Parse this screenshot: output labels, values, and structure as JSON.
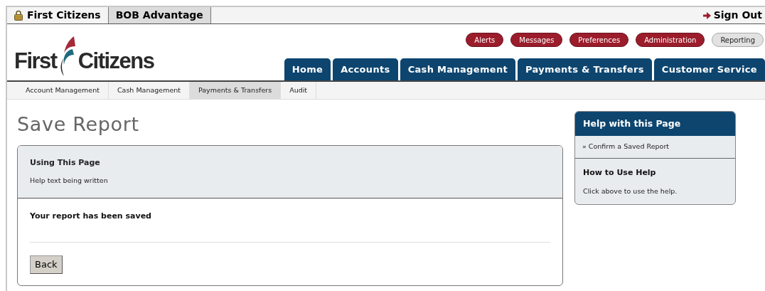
{
  "top_tabs": [
    {
      "label": "First Citizens",
      "kind": "lock",
      "selected": false
    },
    {
      "label": "BOB Advantage",
      "kind": "plain",
      "selected": true
    }
  ],
  "sign_out": "Sign Out",
  "logo": {
    "words": [
      "First",
      "Citizens"
    ]
  },
  "utility_buttons": [
    {
      "label": "Alerts",
      "selected": false
    },
    {
      "label": "Messages",
      "selected": false
    },
    {
      "label": "Preferences",
      "selected": false
    },
    {
      "label": "Administration",
      "selected": false
    },
    {
      "label": "Reporting",
      "selected": true
    }
  ],
  "main_nav": [
    "Home",
    "Accounts",
    "Cash Management",
    "Payments & Transfers",
    "Customer Service"
  ],
  "sub_nav": [
    {
      "label": "Account Management",
      "selected": false
    },
    {
      "label": "Cash Management",
      "selected": false
    },
    {
      "label": "Payments & Transfers",
      "selected": true
    },
    {
      "label": "Audit",
      "selected": false
    }
  ],
  "page_title": "Save Report",
  "panel": {
    "heading": "Using This Page",
    "help_text": "Help text being written",
    "message": "Your report has been saved",
    "button": "Back"
  },
  "help_box": {
    "title": "Help with this Page",
    "link_marker": "»",
    "link": "Confirm a Saved Report",
    "subheading": "How to Use Help",
    "text": "Click above to use the help."
  }
}
